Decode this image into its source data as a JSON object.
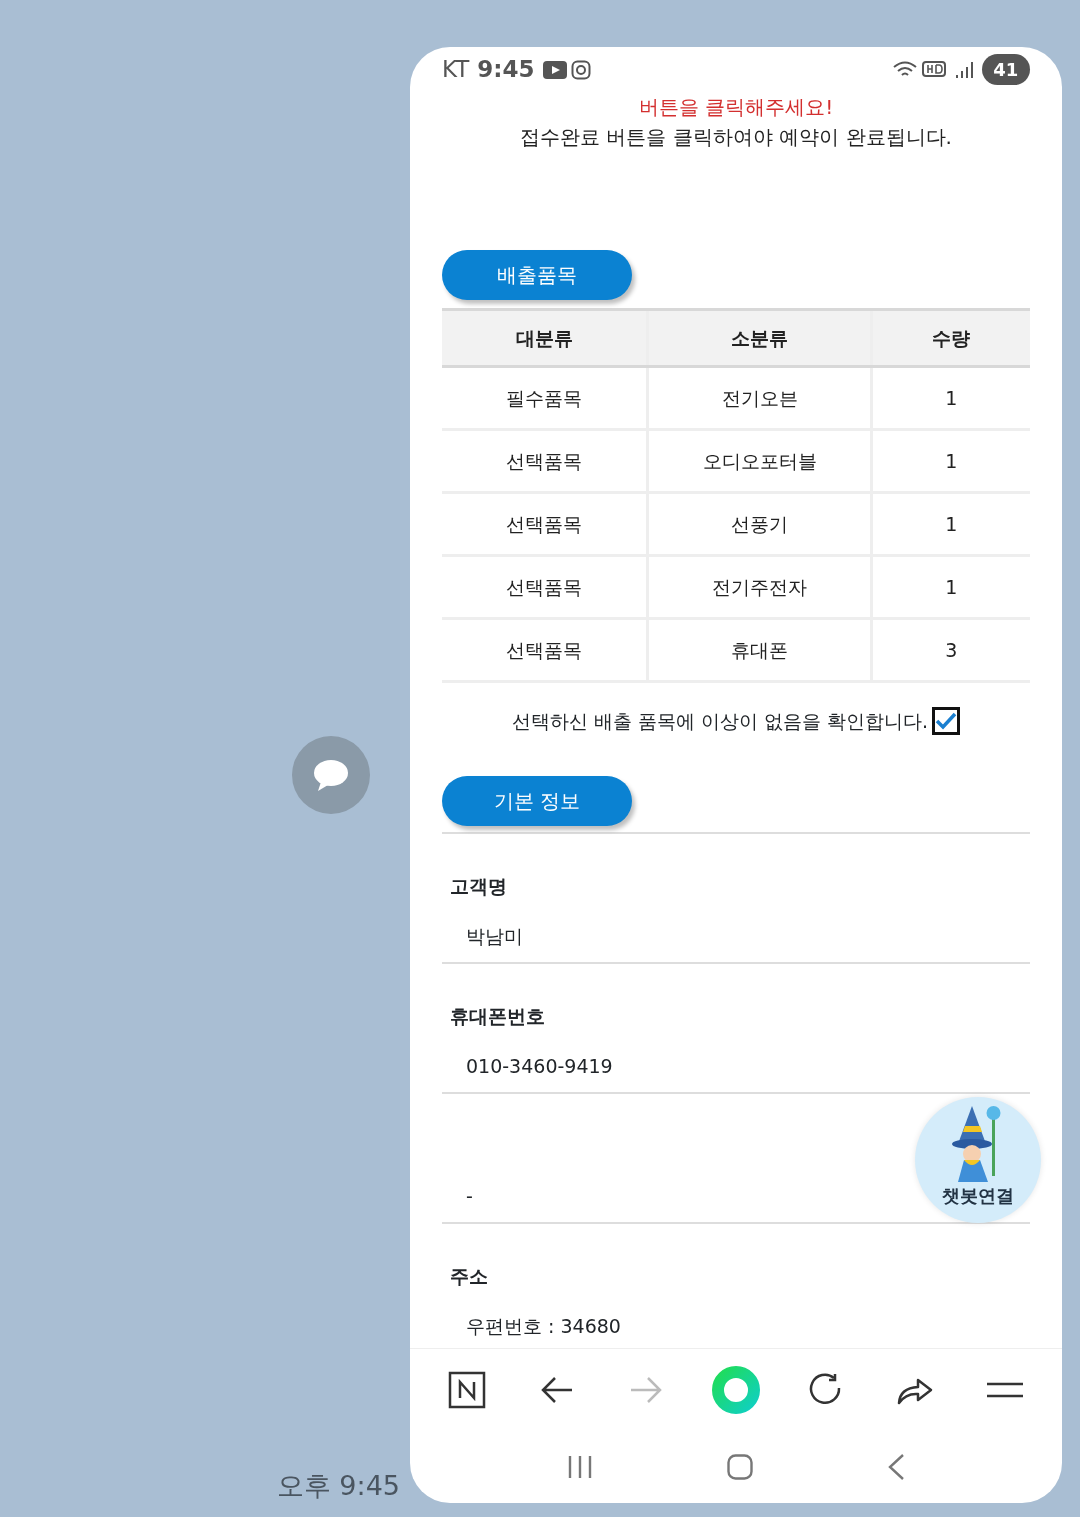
{
  "status_bar": {
    "carrier": "KT",
    "time": "9:45",
    "battery": "41"
  },
  "notice": {
    "alert": "버튼을 클릭해주세요!",
    "message": "접수완료 버튼을 클릭하여야 예약이 완료됩니다."
  },
  "items_section": {
    "title": "배출품목",
    "columns": [
      "대분류",
      "소분류",
      "수량"
    ],
    "rows": [
      [
        "필수품목",
        "전기오븐",
        "1"
      ],
      [
        "선택품목",
        "오디오포터블",
        "1"
      ],
      [
        "선택품목",
        "선풍기",
        "1"
      ],
      [
        "선택품목",
        "전기주전자",
        "1"
      ],
      [
        "선택품목",
        "휴대폰",
        "3"
      ]
    ],
    "confirm": {
      "text": "선택하신 배출 품목에 이상이 없음을 확인합니다.",
      "checked": true
    }
  },
  "basic_info": {
    "title": "기본 정보",
    "fields": [
      {
        "label": "고객명",
        "value": "박남미"
      },
      {
        "label": "휴대폰번호",
        "value": "010-3460-9419"
      },
      {
        "value": "-"
      },
      {
        "label": "주소",
        "value": "우편번호 : 34680"
      }
    ]
  },
  "chatbot": {
    "label": "챗봇연결"
  },
  "toolbar": [
    {
      "kind": "home",
      "disabled": false
    },
    {
      "kind": "back",
      "disabled": false
    },
    {
      "kind": "forward",
      "disabled": true
    },
    {
      "kind": "green",
      "disabled": false
    },
    {
      "kind": "reload",
      "disabled": false
    },
    {
      "kind": "share",
      "disabled": false
    },
    {
      "kind": "menu",
      "disabled": false
    }
  ],
  "message_time": "오후 9:45"
}
